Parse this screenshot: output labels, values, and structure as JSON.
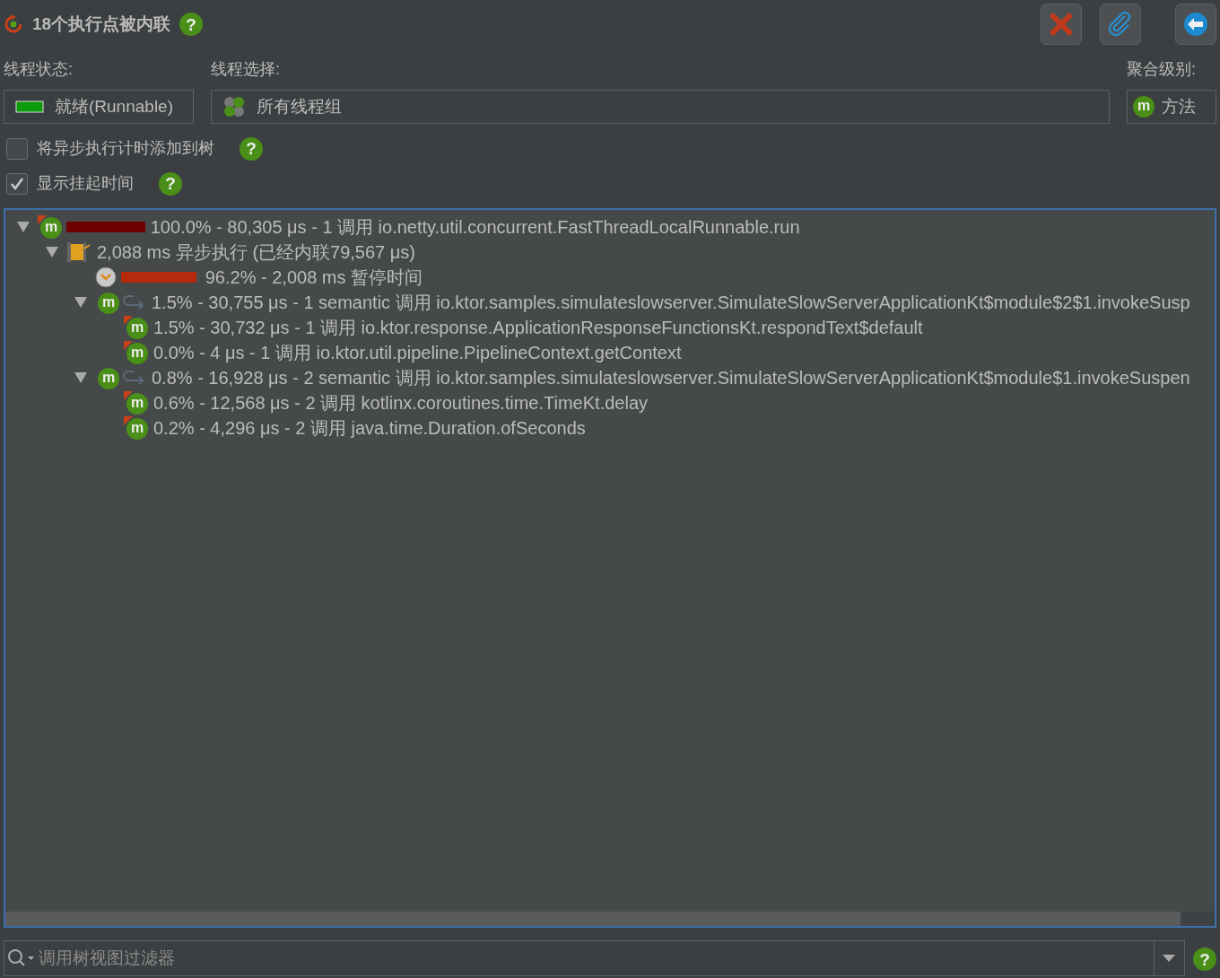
{
  "header": {
    "title": "18个执行点被内联",
    "help": "?"
  },
  "thread_state": {
    "label": "线程状态:",
    "value": "就绪(Runnable)"
  },
  "thread_selection": {
    "label": "线程选择:",
    "value": "所有线程组"
  },
  "aggregation": {
    "label": "聚合级别:",
    "icon": "m",
    "value": "方法"
  },
  "options": [
    {
      "label": "将异步执行计时添加到树",
      "checked": false,
      "help": "?"
    },
    {
      "label": "显示挂起时间",
      "checked": true,
      "help": "?"
    }
  ],
  "tree": [
    {
      "kind": "method",
      "icon": "m",
      "hot": true,
      "level": 1.0,
      "expanded": true,
      "text": "100.0% - 80,305 μs - 1 调用 io.netty.util.concurrent.FastThreadLocalRunnable.run",
      "children": [
        {
          "kind": "async",
          "expanded": true,
          "text": "2,088 ms 异步执行 (已经内联79,567 μs)",
          "children": [
            {
              "kind": "pause",
              "level": 0.962,
              "text": "96.2% - 2,008 ms 暂停时间"
            },
            {
              "kind": "semantic",
              "icon": "m",
              "expanded": true,
              "text": "1.5% - 30,755 μs - 1 semantic 调用 io.ktor.samples.simulateslowserver.SimulateSlowServerApplicationKt$module$2$1.invokeSusp",
              "children": [
                {
                  "kind": "method",
                  "icon": "m",
                  "hot": true,
                  "text": "1.5% - 30,732 μs - 1 调用 io.ktor.response.ApplicationResponseFunctionsKt.respondText$default"
                },
                {
                  "kind": "method",
                  "icon": "m",
                  "hot": true,
                  "text": "0.0% - 4 μs - 1 调用 io.ktor.util.pipeline.PipelineContext.getContext"
                }
              ]
            },
            {
              "kind": "semantic",
              "icon": "m",
              "expanded": true,
              "text": "0.8% - 16,928 μs - 2 semantic 调用 io.ktor.samples.simulateslowserver.SimulateSlowServerApplicationKt$module$1.invokeSuspen",
              "children": [
                {
                  "kind": "method",
                  "icon": "m",
                  "hot": true,
                  "text": "0.6% - 12,568 μs - 2 调用 kotlinx.coroutines.time.TimeKt.delay"
                },
                {
                  "kind": "method",
                  "icon": "m",
                  "hot": true,
                  "text": "0.2% - 4,296 μs - 2 调用 java.time.Duration.ofSeconds"
                }
              ]
            }
          ]
        }
      ]
    }
  ],
  "filter": {
    "placeholder": "调用树视图过滤器",
    "help": "?"
  }
}
